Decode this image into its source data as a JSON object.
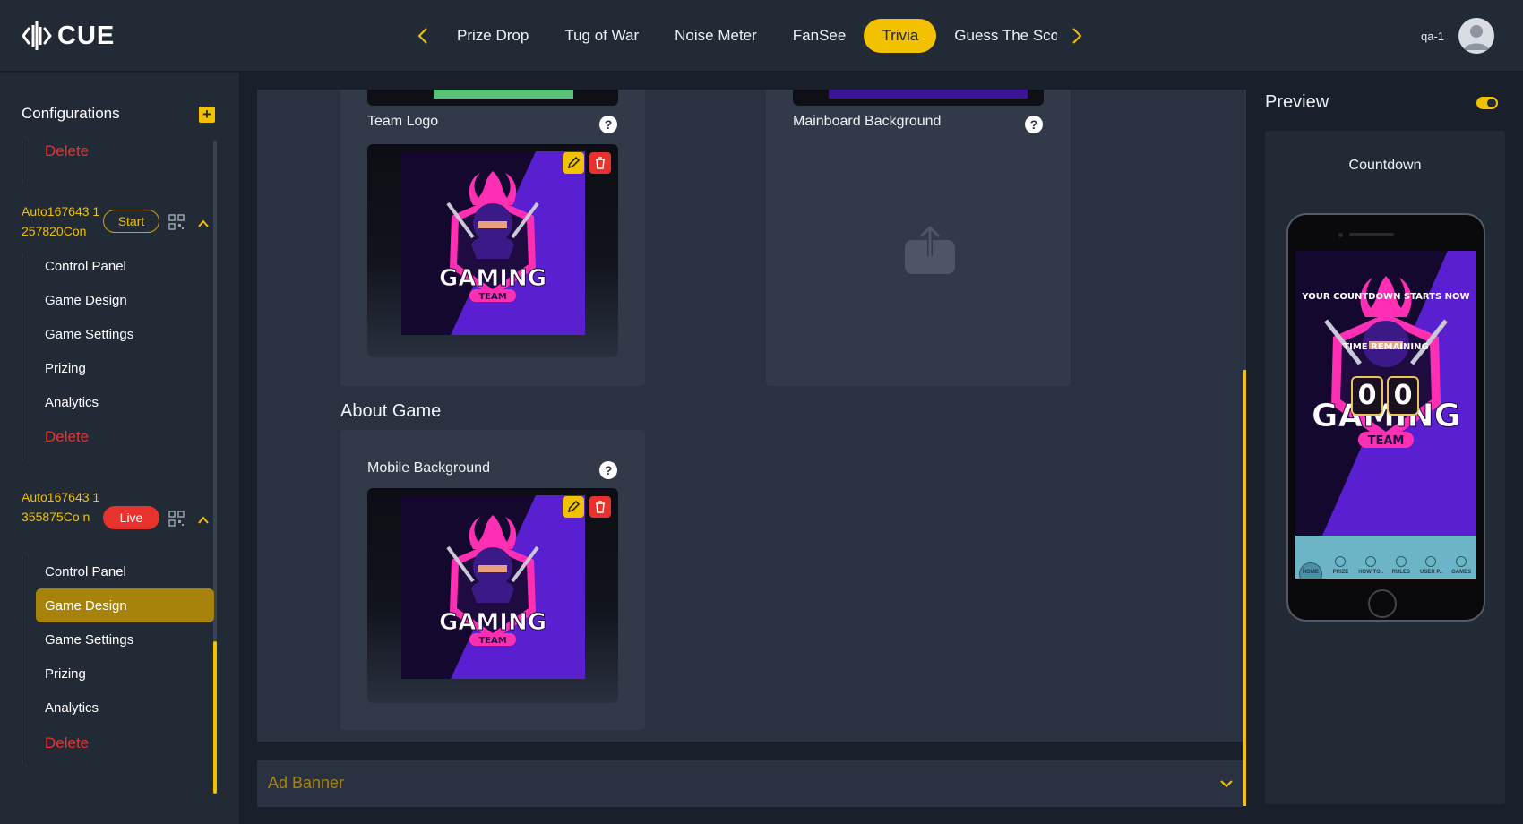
{
  "app": {
    "logo_text": "CUE"
  },
  "topnav": {
    "tabs": [
      "Prize Drop",
      "Tug of War",
      "Noise Meter",
      "FanSee",
      "Trivia",
      "Guess The Sco"
    ],
    "active_tab": "Trivia",
    "user_name": "qa-1"
  },
  "sidebar": {
    "title": "Configurations",
    "first_delete": "Delete",
    "games": [
      {
        "name": "Auto167643 1257820Con",
        "status": "Start",
        "items": [
          "Control Panel",
          "Game Design",
          "Game Settings",
          "Prizing",
          "Analytics"
        ],
        "delete": "Delete"
      },
      {
        "name": "Auto167643 1355875Co n",
        "status": "Live",
        "items": [
          "Control Panel",
          "Game Design",
          "Game Settings",
          "Prizing",
          "Analytics"
        ],
        "active_item": "Game Design",
        "delete": "Delete"
      }
    ]
  },
  "editor": {
    "team_logo_label": "Team Logo",
    "mainboard_bg_label": "Mainboard Background",
    "about_game_title": "About Game",
    "mobile_bg_label": "Mobile Background",
    "ad_banner_label": "Ad Banner",
    "help_glyph": "?"
  },
  "artwork": {
    "logo_word": "GAMING",
    "logo_sub": "TEAM"
  },
  "preview": {
    "title": "Preview",
    "screen_name": "Countdown",
    "headline": "Your Countdown Starts Now",
    "time_label": "Time Remaining",
    "digits": [
      "0",
      "0"
    ],
    "logo_word": "GAMING",
    "logo_sub": "TEAM",
    "nav_items": [
      "HOME",
      "PRIZE",
      "HOW TO..",
      "RULES",
      "USER P..",
      "GAMES"
    ]
  },
  "colors": {
    "accent": "#f2c200",
    "danger": "#e8322e",
    "panel": "#2a3140",
    "card": "#323a4a",
    "purple": "#5a1fd0",
    "magenta": "#ff2fb4"
  }
}
